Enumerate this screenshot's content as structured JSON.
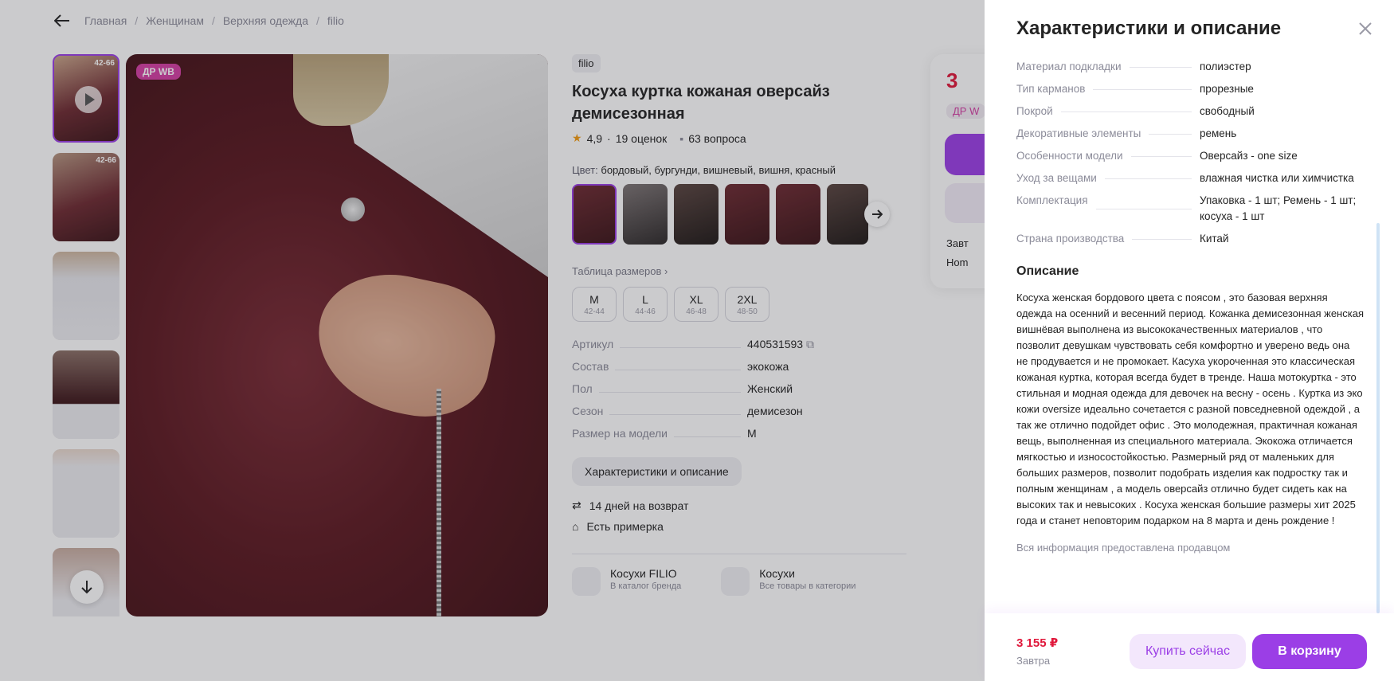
{
  "breadcrumb": {
    "items": [
      "Главная",
      "Женщинам",
      "Верхняя одежда",
      "filio"
    ]
  },
  "product": {
    "badge": "ДР WB",
    "thumb_badge": "42-66",
    "brand": "filio",
    "title": "Косуха куртка кожаная оверсайз демисезонная",
    "rating": "4,9",
    "reviews": "19 оценок",
    "questions": "63 вопроса",
    "color_label": "Цвет:",
    "color_value": "бордовый, бургунди, вишневый, вишня, красный",
    "size_table_link": "Таблица размеров",
    "sizes": [
      {
        "size": "M",
        "range": "42-44"
      },
      {
        "size": "L",
        "range": "44-46"
      },
      {
        "size": "XL",
        "range": "46-48"
      },
      {
        "size": "2XL",
        "range": "48-50"
      }
    ],
    "specs": [
      {
        "k": "Артикул",
        "v": "440531593"
      },
      {
        "k": "Состав",
        "v": "экокожа"
      },
      {
        "k": "Пол",
        "v": "Женский"
      },
      {
        "k": "Сезон",
        "v": "демисезон"
      },
      {
        "k": "Размер на модели",
        "v": "M"
      }
    ],
    "char_button": "Характеристики и описание",
    "return": "14 дней на возврат",
    "fitting": "Есть примерка",
    "brand_link": {
      "title": "Косухи FILIO",
      "sub": "В каталог бренда"
    },
    "cat_link": {
      "title": "Косухи",
      "sub": "Все товары в категории"
    }
  },
  "buybox": {
    "price": "3",
    "tag": "ДР W",
    "line1": "Завт",
    "line2": "Hom"
  },
  "panel": {
    "title": "Характеристики и описание",
    "specs": [
      {
        "k": "Материал подкладки",
        "v": "полиэстер"
      },
      {
        "k": "Тип карманов",
        "v": "прорезные"
      },
      {
        "k": "Покрой",
        "v": "свободный"
      },
      {
        "k": "Декоративные элементы",
        "v": "ремень"
      },
      {
        "k": "Особенности модели",
        "v": "Оверсайз - one size"
      },
      {
        "k": "Уход за вещами",
        "v": "влажная чистка или химчистка"
      },
      {
        "k": "Комплектация",
        "v": "Упаковка - 1 шт; Ремень - 1 шт; косуха - 1 шт"
      },
      {
        "k": "Страна производства",
        "v": "Китай"
      }
    ],
    "desc_title": "Описание",
    "description": "Косуха женская бордового цвета с поясом , это базовая верхняя одежда на осенний и весенний период. Кожанка демисезонная женская вишнёвая выполнена из высококачественных материалов , что позволит девушкам чувствовать себя комфортно и уверено ведь она не продувается и не промокает. Касуха укороченная это классическая кожаная куртка, которая всегда будет в тренде. Наша мотокуртка - это стильная и модная одежда для девочек на весну - осень . Куртка из эко кожи oversize идеально сочетается с разной повседневной одеждой , а так же отлично подойдет офис . Это молодежная, практичная кожаная вещь, выполненная из специального материала. Экокожа отличается мягкостью и износостойкостью. Размерный ряд от маленьких для больших размеров, позволит подобрать изделия как подростку так и полным женщинам , а модель оверсайз отлично будет сидеть как на высоких так и невысоких . Косуха женская большие размеры хит 2025 года и станет неповторим подарком на 8 марта и день рождение !",
    "seller_note": "Вся информация предоставлена продавцом"
  },
  "footer": {
    "price": "3 155 ₽",
    "date": "Завтра",
    "buy_now": "Купить сейчас",
    "to_cart": "В корзину"
  },
  "colors": {
    "accent": "#9b3ee6",
    "price": "#e0183b",
    "badge": "#d43fa4"
  },
  "icons": [
    "arrow-left-icon",
    "play-icon",
    "chevron-down-icon",
    "star-icon",
    "chat-icon",
    "chevron-right-icon",
    "copy-icon",
    "return-icon",
    "hanger-icon",
    "tag-icon",
    "layers-icon",
    "close-icon"
  ]
}
